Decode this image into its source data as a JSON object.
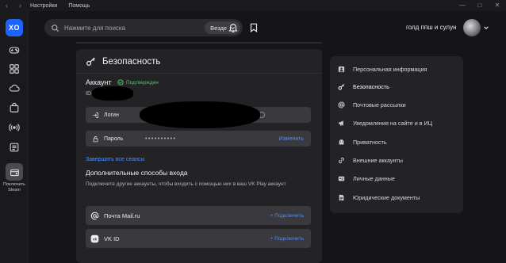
{
  "topbar": {
    "menu": [
      "Настройки",
      "Помощь"
    ],
    "nav_back": "‹",
    "nav_forward": "›",
    "window_min": "—",
    "window_max": "□",
    "window_close": "✕"
  },
  "sidebar": {
    "logo_text": "XO",
    "icons": [
      "gamepad-icon",
      "games-grid-icon",
      "cloud-icon",
      "bag-icon",
      "broadcast-icon",
      "news-icon"
    ],
    "steam_label": "Поключить Steam"
  },
  "header": {
    "search_placeholder": "Нажмите для поиска",
    "search_scope": "Везде",
    "username": "голд ппш и сулун"
  },
  "security": {
    "title": "Безопасность",
    "account_label": "Аккаунт",
    "verified_label": "Подтвержден",
    "id_label": "ID",
    "login_label": "Логин",
    "password_label": "Пароль",
    "password_value": "••••••••••",
    "change_action": "Изменить",
    "end_sessions_link": "Завершить все сеансы",
    "alt_title": "Дополнительные способы входа",
    "alt_desc": "Подключите другие аккаунты, чтобы входить с помощью них в ваш VK Play аккаунт",
    "alt_methods": [
      {
        "name": "Почта Mail.ru",
        "action": "+ Подключить"
      },
      {
        "name": "VK ID",
        "action": "+ Подключить"
      }
    ]
  },
  "settings_menu": {
    "items": [
      {
        "label": "Персональная информация",
        "icon": "user-icon"
      },
      {
        "label": "Безопасность",
        "icon": "key-icon",
        "active": true
      },
      {
        "label": "Почтовые рассылки",
        "icon": "at-icon"
      },
      {
        "label": "Уведомления на сайте и в ИЦ",
        "icon": "megaphone-icon"
      },
      {
        "label": "Приватность",
        "icon": "ghost-icon"
      },
      {
        "label": "Внешние аккаунты",
        "icon": "link-icon"
      },
      {
        "label": "Личные данные",
        "icon": "card-icon"
      },
      {
        "label": "Юридические документы",
        "icon": "document-icon"
      }
    ]
  },
  "colors": {
    "accent_blue": "#4f8dff",
    "logo_blue": "#1d64ff",
    "verified_green": "#56c26a",
    "background": "#151517",
    "card": "#232326"
  }
}
